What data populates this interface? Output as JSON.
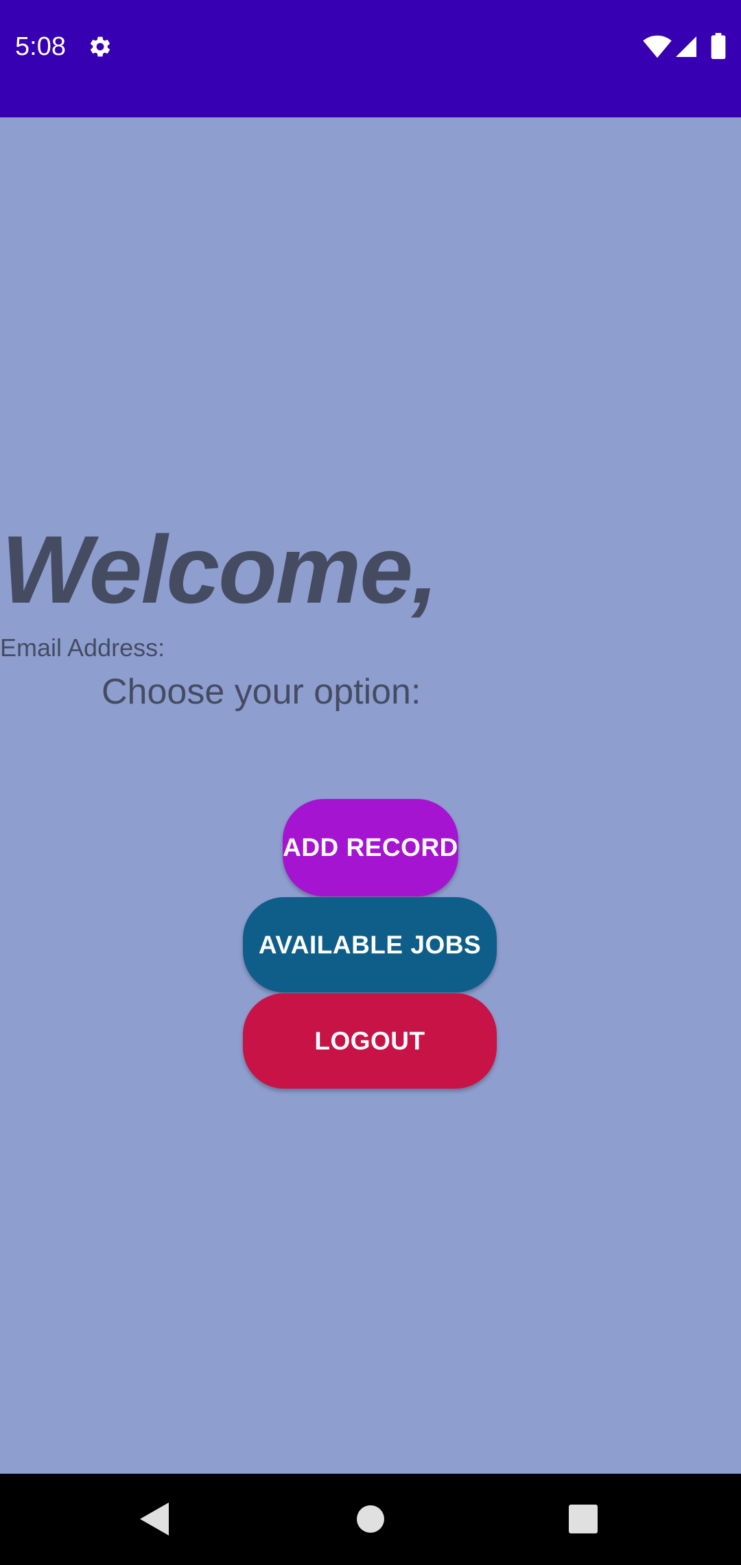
{
  "status_bar": {
    "time": "5:08",
    "background_color": "#3700b3",
    "icons": [
      "gear-icon",
      "wifi-icon",
      "signal-icon",
      "battery-icon"
    ]
  },
  "main": {
    "background_color": "#8e9ecf",
    "welcome_title": "Welcome,",
    "email_label": "Email Address:",
    "choose_label": "Choose your option:"
  },
  "buttons": {
    "add_record": {
      "label": "ADD RECORD",
      "color": "#a514d1"
    },
    "available_jobs": {
      "label": "AVAILABLE JOBS",
      "color": "#0f5e8a"
    },
    "logout": {
      "label": "LOGOUT",
      "color": "#c81346"
    }
  },
  "nav_bar": {
    "icons": [
      "back-icon",
      "home-icon",
      "recents-icon"
    ]
  }
}
